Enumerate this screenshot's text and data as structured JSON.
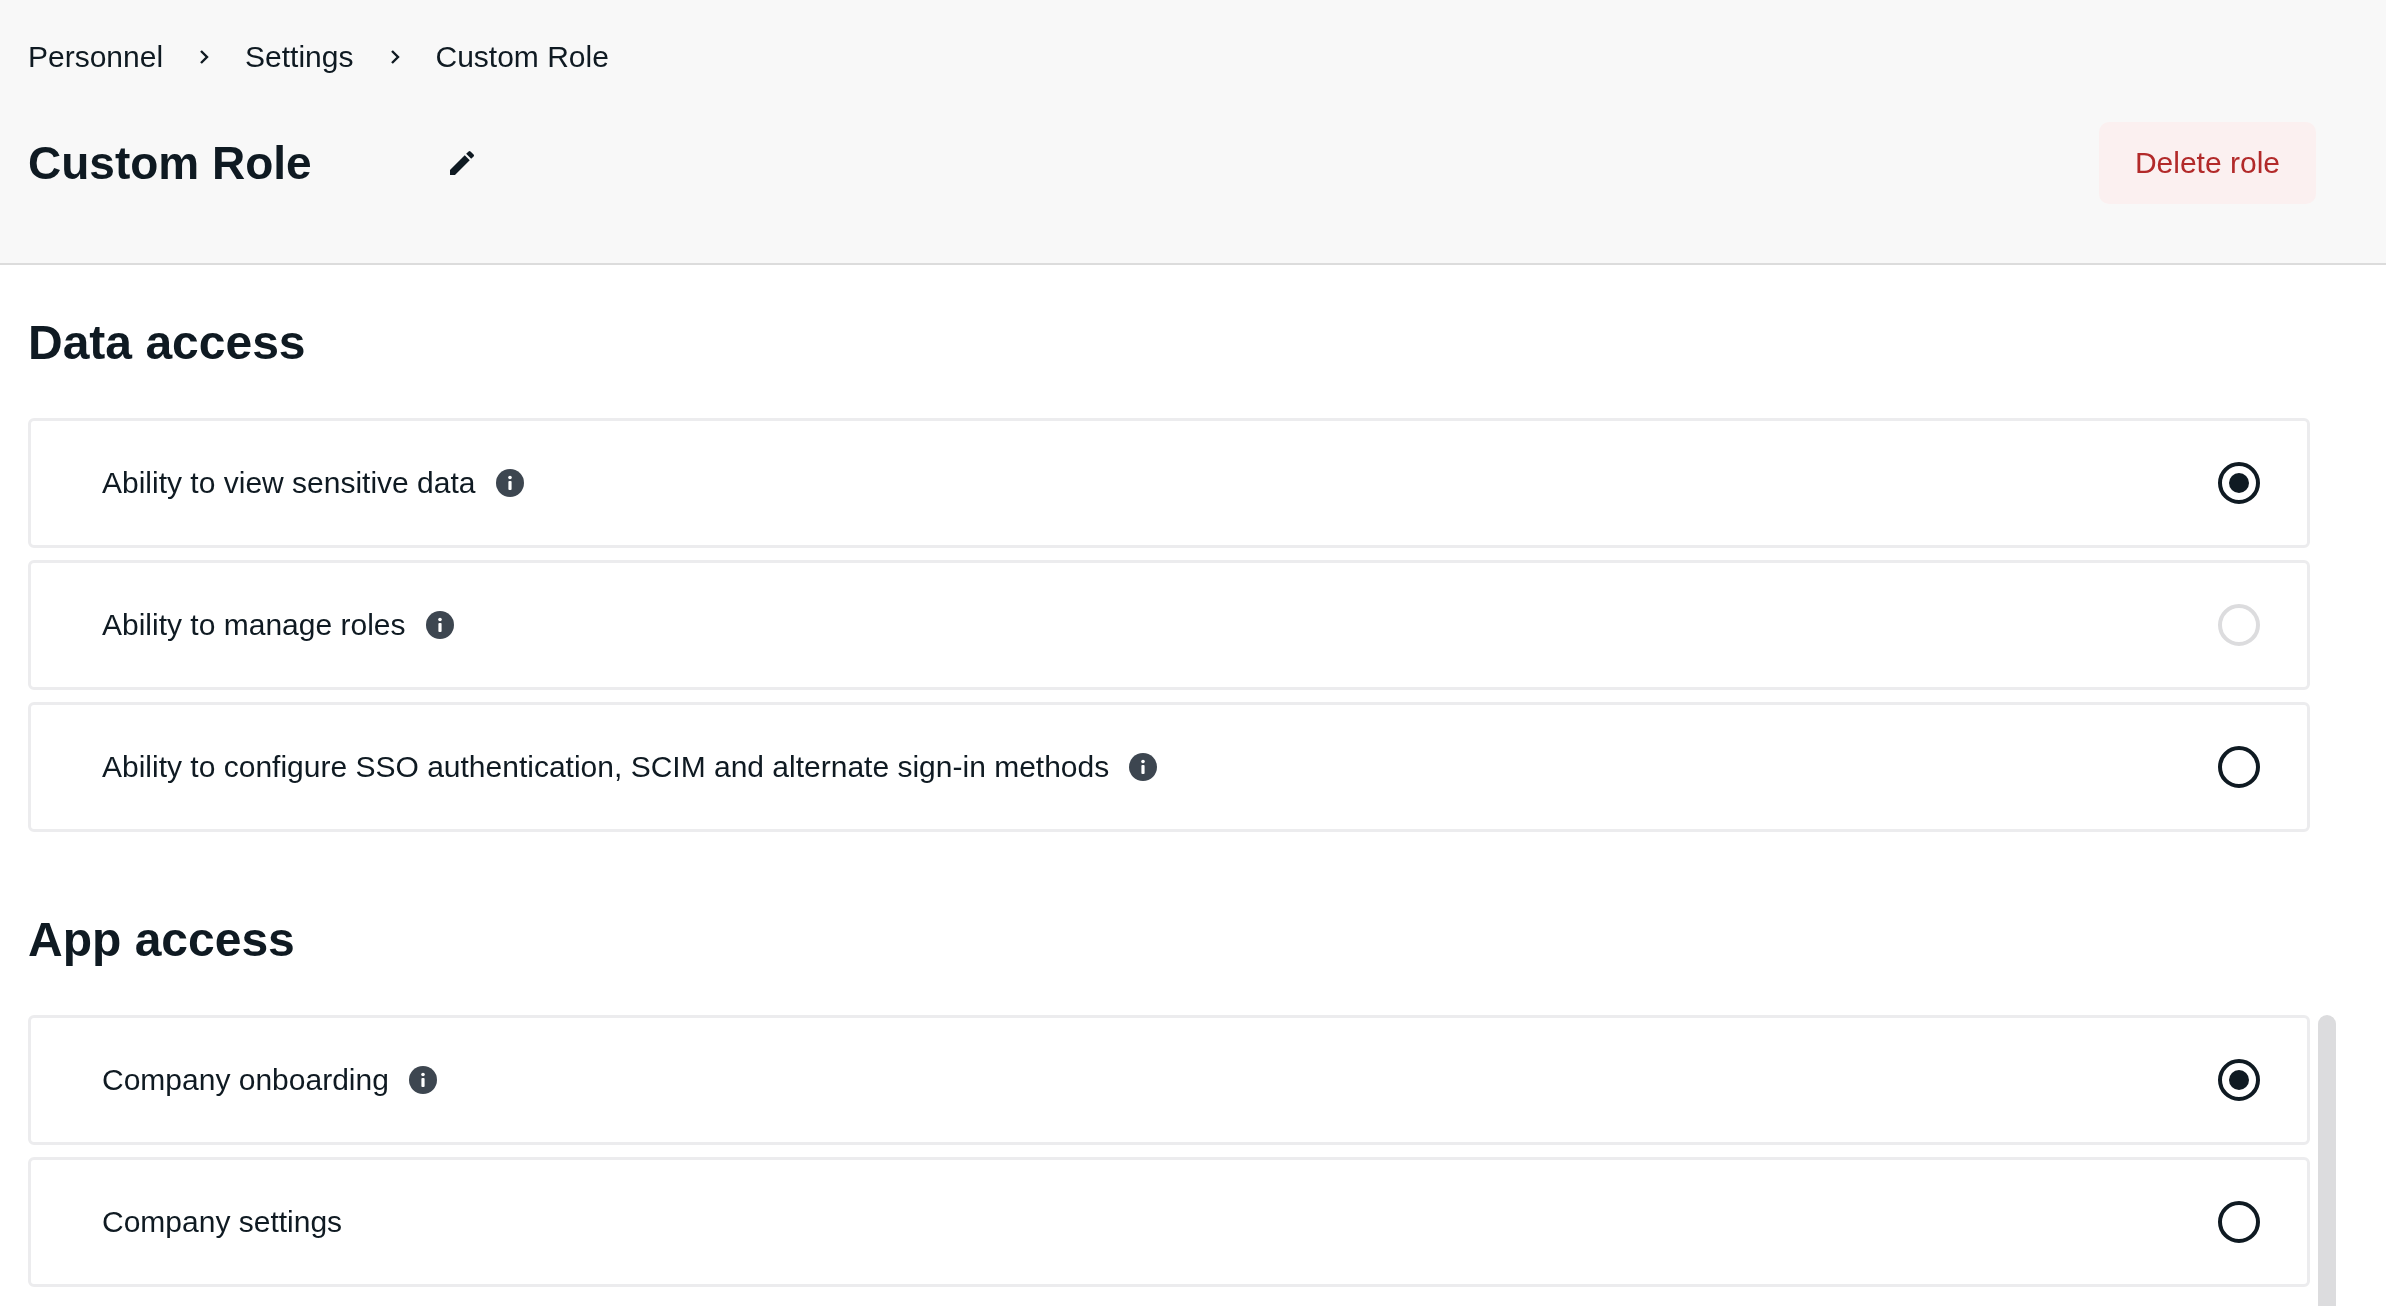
{
  "breadcrumb": [
    {
      "label": "Personnel"
    },
    {
      "label": "Settings"
    },
    {
      "label": "Custom Role"
    }
  ],
  "title": "Custom Role",
  "delete_button": "Delete role",
  "sections": [
    {
      "heading": "Data access",
      "options": [
        {
          "label": "Ability to view sensitive data",
          "selected": true,
          "disabled": false
        },
        {
          "label": "Ability to manage roles",
          "selected": false,
          "disabled": true
        },
        {
          "label": "Ability to configure SSO authentication, SCIM and alternate sign-in methods",
          "selected": false,
          "disabled": false
        }
      ]
    },
    {
      "heading": "App access",
      "options": [
        {
          "label": "Company onboarding",
          "selected": true,
          "disabled": false
        },
        {
          "label": "Company settings",
          "selected": false,
          "disabled": false,
          "info": false
        }
      ]
    }
  ]
}
